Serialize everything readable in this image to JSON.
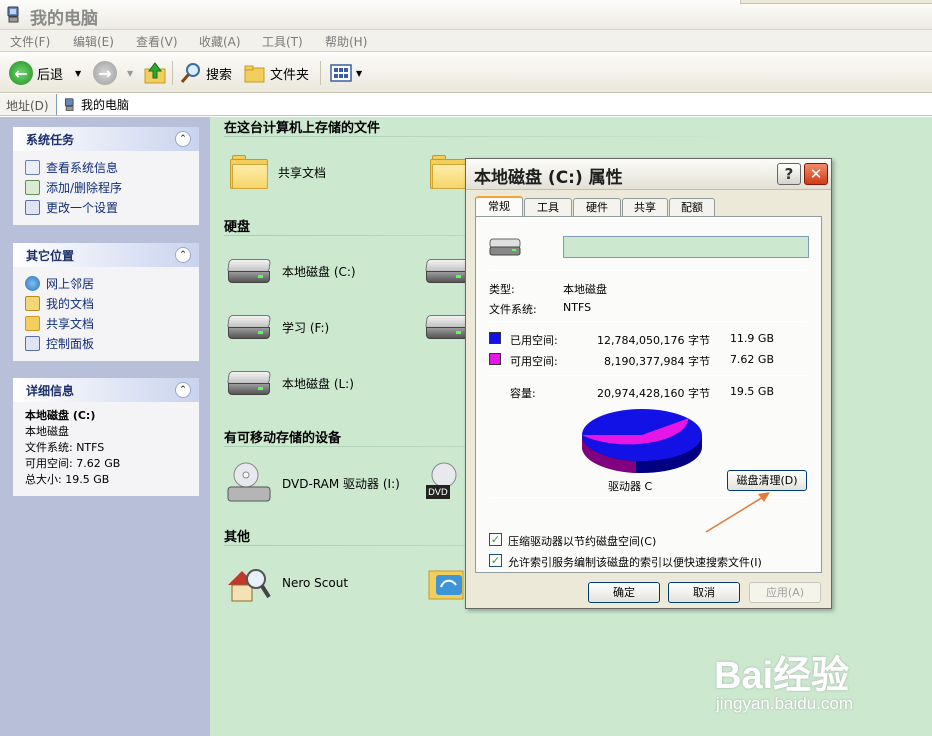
{
  "window": {
    "title": "我的电脑"
  },
  "menu": [
    "文件(F)",
    "编辑(E)",
    "查看(V)",
    "收藏(A)",
    "工具(T)",
    "帮助(H)"
  ],
  "toolbar": {
    "back_label": "后退",
    "search_label": "搜索",
    "folders_label": "文件夹"
  },
  "address": {
    "label": "地址(D)",
    "value": "我的电脑"
  },
  "sidebar": {
    "system_tasks": {
      "title": "系统任务",
      "items": [
        "查看系统信息",
        "添加/删除程序",
        "更改一个设置"
      ]
    },
    "other_places": {
      "title": "其它位置",
      "items": [
        "网上邻居",
        "我的文档",
        "共享文档",
        "控制面板"
      ]
    },
    "details": {
      "title": "详细信息",
      "name": "本地磁盘 (C:)",
      "type": "本地磁盘",
      "filesystem": "文件系统: NTFS",
      "free": "可用空间: 7.62 GB",
      "total": "总大小: 19.5 GB"
    }
  },
  "main": {
    "sections": {
      "stored_files": "在这台计算机上存储的文件",
      "hard_disks": "硬盘",
      "removable": "有可移动存储的设备",
      "other": "其他"
    },
    "items": {
      "shared_docs": "共享文档",
      "drive_c": "本地磁盘 (C:)",
      "drive_f": "学习 (F:)",
      "drive_l": "本地磁盘 (L:)",
      "dvd": "DVD-RAM 驱动器 (I:)",
      "nero": "Nero Scout",
      "dvd_badge": "DVD"
    }
  },
  "dialog": {
    "title": "本地磁盘 (C:) 属性",
    "help_btn": "?",
    "close_btn": "✕",
    "tabs": [
      "常规",
      "工具",
      "硬件",
      "共享",
      "配额"
    ],
    "volume_label": "",
    "type_label": "类型:",
    "type_value": "本地磁盘",
    "fs_label": "文件系统:",
    "fs_value": "NTFS",
    "used_label": "已用空间:",
    "used_bytes": "12,784,050,176 字节",
    "used_gb": "11.9 GB",
    "free_label": "可用空间:",
    "free_bytes": "8,190,377,984 字节",
    "free_gb": "7.62 GB",
    "capacity_label": "容量:",
    "capacity_bytes": "20,974,428,160 字节",
    "capacity_gb": "19.5 GB",
    "drive_label": "驱动器 C",
    "cleanup_btn": "磁盘清理(D)",
    "compress_label": "压缩驱动器以节约磁盘空间(C)",
    "index_label": "允许索引服务编制该磁盘的索引以便快速搜索文件(I)",
    "ok_btn": "确定",
    "cancel_btn": "取消",
    "apply_btn": "应用(A)",
    "used_fraction": 0.61,
    "used_color": "#1212e6",
    "free_color": "#e616e6"
  },
  "watermark": {
    "logo": "Bai经验",
    "url": "jingyan.baidu.com"
  }
}
